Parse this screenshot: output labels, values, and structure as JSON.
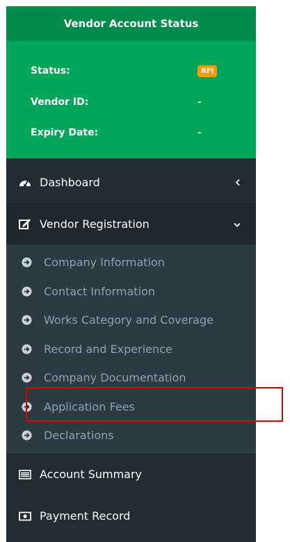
{
  "status_panel": {
    "title": "Vendor Account Status",
    "rows": [
      {
        "label": "Status:",
        "value": "RFI"
      },
      {
        "label": "Vendor ID:",
        "value": "-"
      },
      {
        "label": "Expiry Date:",
        "value": "-"
      }
    ]
  },
  "menu": {
    "dashboard": {
      "label": "Dashboard",
      "icon": "dashboard-gauge-icon"
    },
    "vendor_registration": {
      "label": "Vendor Registration",
      "icon": "edit-icon",
      "items": [
        {
          "label": "Company Information"
        },
        {
          "label": "Contact Information"
        },
        {
          "label": "Works Category and Coverage"
        },
        {
          "label": "Record and Experience"
        },
        {
          "label": "Company Documentation"
        },
        {
          "label": "Application Fees"
        },
        {
          "label": "Declarations"
        }
      ]
    },
    "account_summary": {
      "label": "Account Summary",
      "icon": "list-icon"
    },
    "payment_record": {
      "label": "Payment Record",
      "icon": "money-icon"
    }
  },
  "colors": {
    "sidebar_bg": "#222d32",
    "status_header_bg": "#008d4c",
    "status_box_bg": "#00a65a",
    "badge_bg": "#f39c12",
    "submenu_bg": "#2c3b41",
    "highlight": "#e00000"
  }
}
